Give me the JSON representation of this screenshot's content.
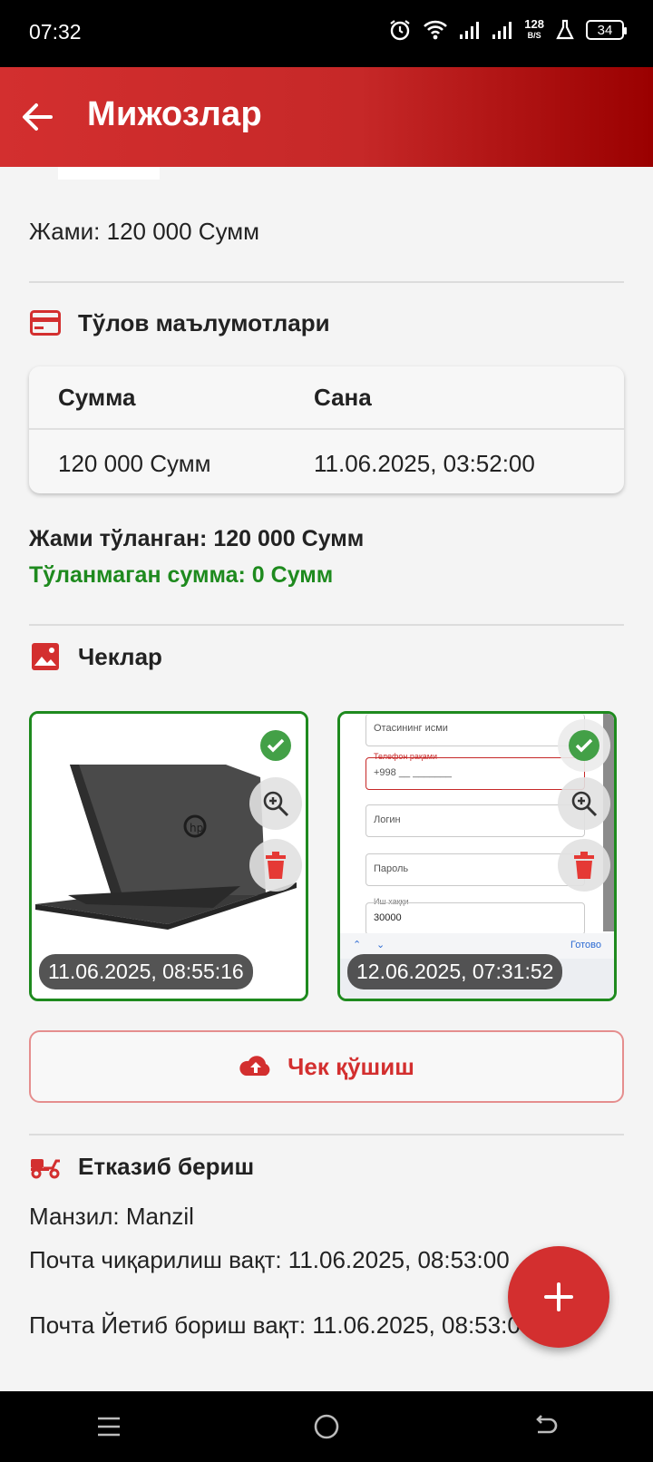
{
  "status_bar": {
    "time": "07:32",
    "net_speed": "128",
    "net_unit": "B/S",
    "battery": "34"
  },
  "app_bar": {
    "title": "Мижозлар"
  },
  "summary": {
    "total_text": "Жами: 120 000 Сумм"
  },
  "payments": {
    "section_title": "Тўлов маълумотлари",
    "headers": {
      "amount": "Сумма",
      "date": "Сана"
    },
    "rows": [
      {
        "amount": "120 000 Сумм",
        "date": "11.06.2025, 03:52:00"
      }
    ],
    "paid_text": "Жами тўланган: 120 000 Сумм",
    "unpaid_text": "Тўланмаган сумма: 0 Сумм"
  },
  "receipts": {
    "section_title": "Чеклар",
    "items": [
      {
        "date": "11.06.2025, 08:55:16"
      },
      {
        "date": "12.06.2025, 07:31:52"
      }
    ],
    "mock_form": {
      "father_name": "Отасининг исми",
      "phone_label": "Телефон рақами",
      "phone_placeholder": "+998 __ _______",
      "login": "Логин",
      "password": "Пароль",
      "price_label": "Иш хаққи",
      "price_value": "30000",
      "done": "Готово"
    },
    "add_button": "Чек қўшиш"
  },
  "delivery": {
    "section_title": "Етказиб бериш",
    "address": "Манзил: Manzil",
    "post_out": "Почта чиқарилиш вақт: 11.06.2025, 08:53:00",
    "post_arrive": "Почта Йетиб бориш вақт: 11.06.2025, 08:53:00"
  },
  "colors": {
    "primary": "#d32f2f",
    "success": "#1e8a1e",
    "app_bar_dark": "#9a0000"
  },
  "icons": [
    "alarm-icon",
    "wifi-icon",
    "signal-icon",
    "flask-icon",
    "battery-icon",
    "back-arrow-icon",
    "credit-card-icon",
    "image-icon",
    "check-circle-icon",
    "zoom-in-icon",
    "trash-icon",
    "cloud-upload-icon",
    "delivery-scooter-icon",
    "plus-icon",
    "menu-icon",
    "home-circle-icon",
    "back-nav-icon"
  ]
}
